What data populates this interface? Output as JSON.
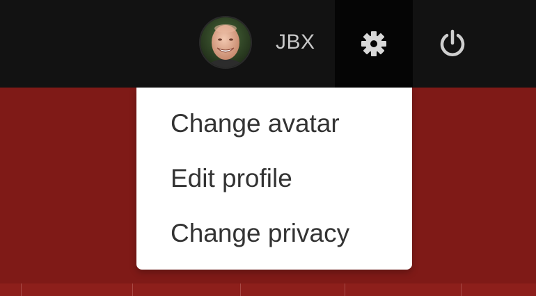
{
  "header": {
    "username": "JBX",
    "icons": {
      "avatar": "user-avatar-photo",
      "settings": "gear-icon",
      "power": "power-icon"
    }
  },
  "menu": {
    "items": [
      {
        "label": "Change avatar"
      },
      {
        "label": "Edit profile"
      },
      {
        "label": "Change privacy"
      }
    ]
  },
  "colors": {
    "topbar": "#121212",
    "settings_active": "#050505",
    "background_red": "#7f1a17",
    "menu_bg": "#ffffff",
    "menu_text": "#333333",
    "header_text": "#c8c8c8"
  }
}
